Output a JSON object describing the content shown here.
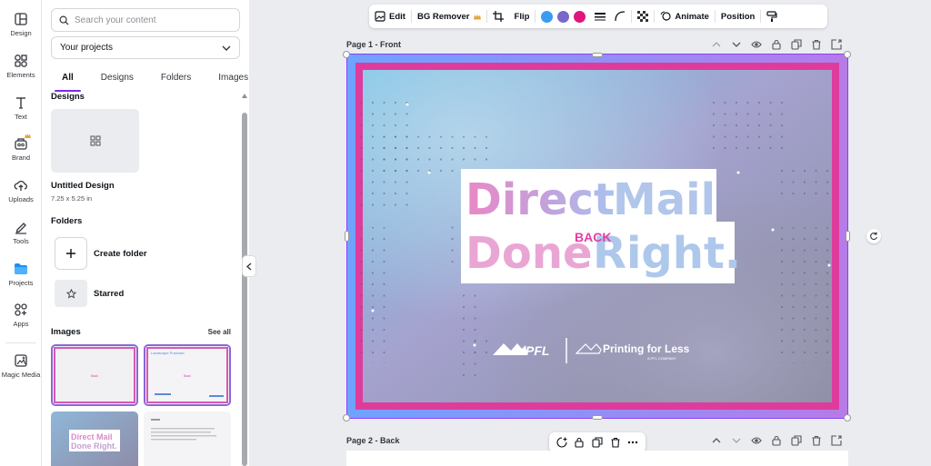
{
  "rail": {
    "items": [
      {
        "label": "Design",
        "icon": "layout-icon"
      },
      {
        "label": "Elements",
        "icon": "shapes-icon"
      },
      {
        "label": "Text",
        "icon": "text-icon"
      },
      {
        "label": "Brand",
        "icon": "brand-icon"
      },
      {
        "label": "Uploads",
        "icon": "upload-icon"
      },
      {
        "label": "Tools",
        "icon": "pen-icon"
      },
      {
        "label": "Projects",
        "icon": "folder-icon"
      },
      {
        "label": "Apps",
        "icon": "apps-icon"
      },
      {
        "label": "Magic Media",
        "icon": "magic-media-icon"
      }
    ],
    "active": "Projects"
  },
  "panel": {
    "search_placeholder": "Search your content",
    "filter_value": "Your projects",
    "tabs": [
      "All",
      "Designs",
      "Folders",
      "Images"
    ],
    "active_tab": "All",
    "designs_title": "Designs",
    "design_name": "Untitled Design",
    "design_size": "7.25 x 5.25 in",
    "folders_title": "Folders",
    "create_folder": "Create folder",
    "starred": "Starred",
    "images_title": "Images",
    "see_all": "See all",
    "thumb_small_text": "Back",
    "thumb2_title": "Landscape Postcard",
    "thumb3_line1": "Direct Mail",
    "thumb3_line2": "Done Right."
  },
  "toolbar": {
    "edit": "Edit",
    "bg_remover": "BG Remover",
    "flip": "Flip",
    "colors": [
      "#3a9cf0",
      "#7a68c8",
      "#e0157d"
    ],
    "animate": "Animate",
    "position": "Position"
  },
  "pages": {
    "page1_label": "Page 1 - Front",
    "page2_label": "Page 2 - Back"
  },
  "design": {
    "line1_a": "Direct",
    "line1_b": "Mail",
    "line2_a": "Done",
    "line2_b": "Right.",
    "back_label": "BACK",
    "logo_left": "PFL",
    "logo_right": "Printing for Less",
    "logo_sub": "A PFL COMPANY",
    "accent_pink": "#e33fa4",
    "accent_blue": "#6fa3ff"
  }
}
